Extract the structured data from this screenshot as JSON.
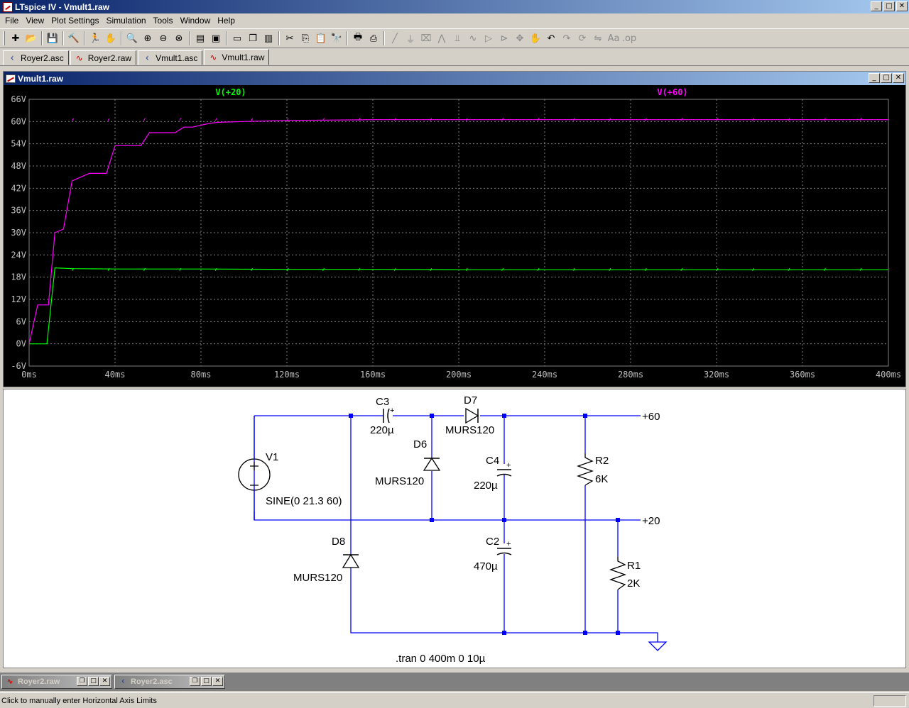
{
  "app": {
    "title": "LTspice IV - Vmult1.raw"
  },
  "window_buttons": [
    "_",
    "□",
    "✕"
  ],
  "menu": [
    "File",
    "View",
    "Plot Settings",
    "Simulation",
    "Tools",
    "Window",
    "Help"
  ],
  "toolbar": {
    "groups": [
      [
        {
          "icon": "new-schematic-icon",
          "glyph": "✚"
        },
        {
          "icon": "open-folder-icon",
          "glyph": "📂"
        }
      ],
      [
        {
          "icon": "save-icon",
          "glyph": "💾"
        }
      ],
      [
        {
          "icon": "control-panel-icon",
          "glyph": "🔨"
        }
      ],
      [
        {
          "icon": "run-icon",
          "glyph": "🏃"
        },
        {
          "icon": "pan-hand-icon",
          "glyph": "✋",
          "dim": true
        }
      ],
      [
        {
          "icon": "zoom-area-icon",
          "glyph": "🔍"
        },
        {
          "icon": "zoom-in-icon",
          "glyph": "⊕"
        },
        {
          "icon": "zoom-out-icon",
          "glyph": "⊖"
        },
        {
          "icon": "zoom-cancel-icon",
          "glyph": "⊗"
        }
      ],
      [
        {
          "icon": "autorange-icon",
          "glyph": "▤"
        },
        {
          "icon": "fit-icon",
          "glyph": "▣"
        }
      ],
      [
        {
          "icon": "tile-horizontal-icon",
          "glyph": "▭"
        },
        {
          "icon": "cascade-icon",
          "glyph": "❐"
        },
        {
          "icon": "tile-vertical-icon",
          "glyph": "▥"
        }
      ],
      [
        {
          "icon": "cut-icon",
          "glyph": "✂"
        },
        {
          "icon": "copy-icon",
          "glyph": "⎘"
        },
        {
          "icon": "paste-icon",
          "glyph": "📋"
        },
        {
          "icon": "find-icon",
          "glyph": "🔭"
        }
      ],
      [
        {
          "icon": "print-preview-icon",
          "glyph": "🖶"
        },
        {
          "icon": "print-icon",
          "glyph": "⎙"
        }
      ],
      [
        {
          "icon": "wire-icon",
          "glyph": "╱",
          "dim": true
        },
        {
          "icon": "ground-icon",
          "glyph": "⏚",
          "dim": true
        },
        {
          "icon": "label-net-icon",
          "glyph": "⌧",
          "dim": true
        },
        {
          "icon": "resistor-icon",
          "glyph": "⋀",
          "dim": true
        },
        {
          "icon": "capacitor-icon",
          "glyph": "⫫",
          "dim": true
        },
        {
          "icon": "inductor-icon",
          "glyph": "∿",
          "dim": true
        },
        {
          "icon": "diode-icon",
          "glyph": "▷",
          "dim": true
        },
        {
          "icon": "component-icon",
          "glyph": "⊳",
          "dim": true
        },
        {
          "icon": "move-icon",
          "glyph": "✥",
          "dim": true
        },
        {
          "icon": "drag-icon",
          "glyph": "✋",
          "dim": true
        },
        {
          "icon": "undo-icon",
          "glyph": "↶",
          "dim": false
        },
        {
          "icon": "redo-icon",
          "glyph": "↷",
          "dim": true
        },
        {
          "icon": "rotate-icon",
          "glyph": "⟳",
          "dim": true
        },
        {
          "icon": "mirror-icon",
          "glyph": "⇋",
          "dim": true
        },
        {
          "icon": "text-icon",
          "glyph": "Aa",
          "dim": true
        },
        {
          "icon": "spice-directive-icon",
          "glyph": ".op",
          "dim": true
        }
      ]
    ]
  },
  "doc_tabs": [
    {
      "label": "Royer2.asc",
      "type": "schematic",
      "active": false
    },
    {
      "label": "Royer2.raw",
      "type": "plot",
      "active": false
    },
    {
      "label": "Vmult1.asc",
      "type": "schematic",
      "active": false
    },
    {
      "label": "Vmult1.raw",
      "type": "plot",
      "active": true
    }
  ],
  "plot_window": {
    "title": "Vmult1.raw"
  },
  "chart_data": {
    "type": "line",
    "title": "",
    "xlabel": "",
    "ylabel": "",
    "xlim": [
      0,
      400
    ],
    "ylim": [
      -6,
      66
    ],
    "grid": true,
    "x_ticks": [
      "0ms",
      "40ms",
      "80ms",
      "120ms",
      "160ms",
      "200ms",
      "240ms",
      "280ms",
      "320ms",
      "360ms",
      "400ms"
    ],
    "y_ticks": [
      "66V",
      "60V",
      "54V",
      "48V",
      "42V",
      "36V",
      "30V",
      "24V",
      "18V",
      "12V",
      "6V",
      "0V",
      "-6V"
    ],
    "background": "#000000",
    "grid_color": "#808080",
    "axis_label_color": "#c0c0c0",
    "series": [
      {
        "name": "V(+20)",
        "color": "#00ff00",
        "x": [
          0,
          8.3,
          12,
          20,
          40,
          80,
          120,
          160,
          200,
          240,
          280,
          320,
          360,
          400
        ],
        "y": [
          0,
          0,
          20.5,
          20.3,
          20.2,
          20.2,
          20.1,
          20.1,
          20.0,
          20.0,
          20.0,
          20.0,
          20.0,
          20.0
        ]
      },
      {
        "name": "V(+60)",
        "color": "#ff00ff",
        "x": [
          0,
          4,
          9,
          12,
          16,
          20,
          28,
          36,
          40,
          44,
          52,
          56,
          60,
          68,
          72,
          76,
          84,
          88,
          100,
          120,
          160,
          200,
          240,
          280,
          320,
          360,
          400
        ],
        "y": [
          0,
          10.5,
          10.5,
          30,
          31,
          44,
          46,
          46,
          53.5,
          53.5,
          53.5,
          57,
          57,
          57,
          58.5,
          58.5,
          59.5,
          59.8,
          60,
          60.3,
          60.5,
          60.5,
          60.5,
          60.5,
          60.5,
          60.5,
          60.5
        ]
      }
    ]
  },
  "schematic": {
    "labels": {
      "C3": "C3",
      "C3_val": "220µ",
      "D7": "D7",
      "D7_val": "MURS120",
      "D6": "D6",
      "D6_val": "MURS120",
      "C4": "C4",
      "C4_val": "220µ",
      "R2": "R2",
      "R2_val": "6K",
      "V1": "V1",
      "V1_val": "SINE(0 21.3 60)",
      "D8": "D8",
      "D8_val": "MURS120",
      "C2": "C2",
      "C2_val": "470µ",
      "R1": "R1",
      "R1_val": "2K",
      "net60": "+60",
      "net20": "+20",
      "directive": ".tran 0 400m 0 10µ",
      "plus": "+"
    },
    "wire_color": "#0000ff",
    "component_color": "#000000"
  },
  "minimized_windows": [
    {
      "label": "Royer2.raw",
      "type": "plot"
    },
    {
      "label": "Royer2.asc",
      "type": "schematic"
    }
  ],
  "status": {
    "text": "Click to manually enter Horizontal Axis Limits"
  }
}
